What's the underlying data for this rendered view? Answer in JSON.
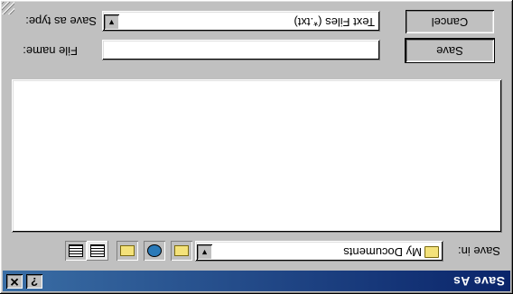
{
  "window": {
    "title": "Save As"
  },
  "title_buttons": {
    "help": "?",
    "close": "✕"
  },
  "save_in": {
    "label": "Save in:",
    "value": "My Documents",
    "icon": "folder-icon"
  },
  "toolbar": {
    "up_icon": "up-folder-icon",
    "desktop_icon": "desktop-icon",
    "new_folder_icon": "new-folder-icon",
    "list_view_icon": "list-view-icon",
    "details_view_icon": "details-view-icon"
  },
  "file_name": {
    "label": "File name:",
    "value": ""
  },
  "save_as_type": {
    "label": "Save as type:",
    "value": "Text Files (*.txt)"
  },
  "buttons": {
    "save": "Save",
    "cancel": "Cancel"
  },
  "colors": {
    "titlebar_start": "#0a246a",
    "titlebar_end": "#3a6ea5",
    "face": "#c0c0c0"
  }
}
